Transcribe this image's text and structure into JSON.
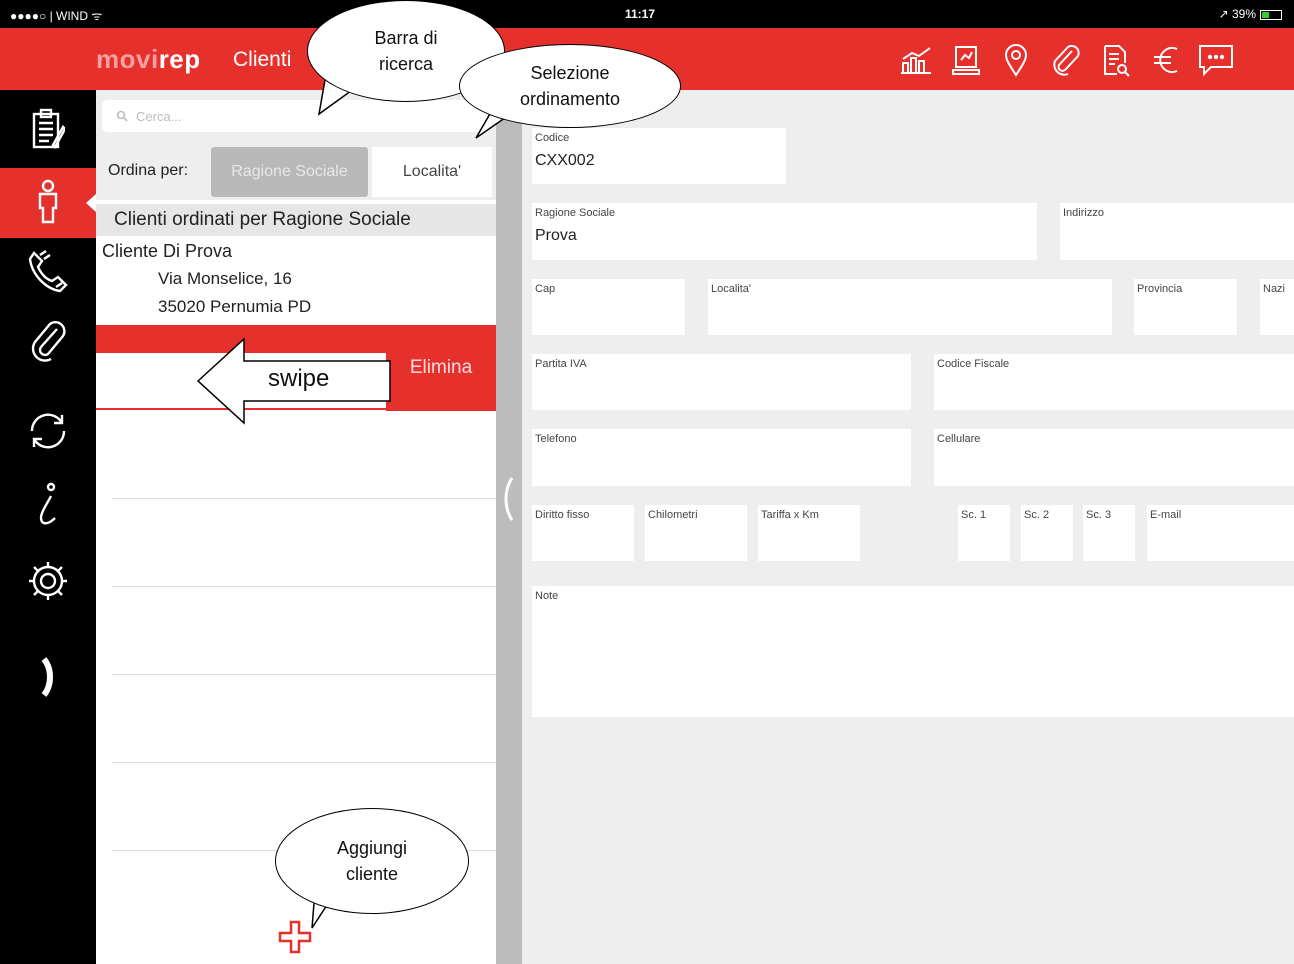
{
  "status_bar": {
    "carrier": "●●●●○ | WIND ᯤ",
    "time": "11:17",
    "battery": "↗ 39%"
  },
  "header": {
    "brand_a": "movi",
    "brand_b": "rep",
    "section": "Clienti",
    "icons": [
      "chart-icon",
      "report-icon",
      "map-pin-icon",
      "paperclip-icon",
      "document-search-icon",
      "euro-icon",
      "chat-icon"
    ]
  },
  "sidebar": {
    "items": [
      "clipboard-icon",
      "person-icon",
      "phone-icon",
      "paperclip-icon",
      "sync-icon",
      "info-icon",
      "gear-icon",
      "expand-icon"
    ],
    "active_index": 1
  },
  "list": {
    "search_placeholder": "Cerca...",
    "sort_label": "Ordina per:",
    "sort_options": [
      "Ragione Sociale",
      "Localita'"
    ],
    "selected_sort": "Ragione Sociale",
    "header": "Clienti ordinati per Ragione Sociale",
    "clients": [
      {
        "name": "Cliente Di Prova",
        "address": "Via Monselice, 16",
        "city": "35020 Pernumia PD"
      }
    ],
    "delete_label": "Elimina"
  },
  "form": {
    "codice": {
      "label": "Codice",
      "value": "CXX002"
    },
    "ragione_sociale": {
      "label": "Ragione Sociale",
      "value": "Prova"
    },
    "indirizzo": {
      "label": "Indirizzo",
      "value": ""
    },
    "cap": {
      "label": "Cap",
      "value": ""
    },
    "localita": {
      "label": "Localita'",
      "value": ""
    },
    "provincia": {
      "label": "Provincia",
      "value": ""
    },
    "nazione": {
      "label": "Nazi",
      "value": ""
    },
    "partita_iva": {
      "label": "Partita IVA",
      "value": ""
    },
    "codice_fiscale": {
      "label": "Codice Fiscale",
      "value": ""
    },
    "telefono": {
      "label": "Telefono",
      "value": ""
    },
    "cellulare": {
      "label": "Cellulare",
      "value": ""
    },
    "diritto_fisso": {
      "label": "Diritto fisso",
      "value": ""
    },
    "chilometri": {
      "label": "Chilometri",
      "value": ""
    },
    "tariffa_km": {
      "label": "Tariffa x Km",
      "value": ""
    },
    "sc1": {
      "label": "Sc. 1",
      "value": ""
    },
    "sc2": {
      "label": "Sc. 2",
      "value": ""
    },
    "sc3": {
      "label": "Sc. 3",
      "value": ""
    },
    "email": {
      "label": "E-mail",
      "value": ""
    },
    "note": {
      "label": "Note",
      "value": ""
    }
  },
  "annotations": {
    "search_bar": "Barra di ricerca",
    "sort_selection": "Selezione ordinamento",
    "swipe": "swipe",
    "add_client": "Aggiungi cliente"
  },
  "colors": {
    "accent": "#e6302c",
    "sidebar": "#000000",
    "form_bg": "#eeeeee"
  }
}
